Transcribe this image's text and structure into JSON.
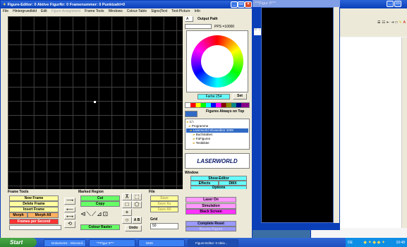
{
  "main_window": {
    "title": "Figure-Editor: 0 Aktive FigurNr: 0 Framenummer: 0 Punktzahl=0",
    "menu": [
      {
        "label": "File",
        "dim": false
      },
      {
        "label": "Hintergrundbild",
        "dim": false
      },
      {
        "label": "Edit",
        "dim": false
      },
      {
        "label": "Figure Assignment",
        "dim": true
      },
      {
        "label": "Frame Tools",
        "dim": false
      },
      {
        "label": "Windows",
        "dim": false
      },
      {
        "label": "Colour-Table",
        "dim": false
      },
      {
        "label": "Signs|Text",
        "dim": false
      },
      {
        "label": "Text-Picture",
        "dim": false
      },
      {
        "label": "Info",
        "dim": false
      }
    ]
  },
  "right_panel": {
    "output_select": "A",
    "output_path_label": "Output Path",
    "pps_label": "PPS =10000",
    "farbe_label": "Farbe 254",
    "set_button": "Set",
    "figures_always_on_top": "Figures Always on Top",
    "tree": [
      {
        "label": "C:\\",
        "selected": false
      },
      {
        "label": "Programme",
        "selected": false
      },
      {
        "label": "Laserworld Showeditor 2009",
        "selected": true
      },
      {
        "label": "Buchstaben",
        "selected": false
      },
      {
        "label": "FaFiguren",
        "selected": false
      },
      {
        "label": "Testbilder",
        "selected": false
      }
    ],
    "logo_text": "LASERWORLD"
  },
  "window_section": {
    "label": "Window",
    "show_editor": "Show-Editor",
    "effects": "Effects",
    "dmx": "DMX",
    "options": "Options"
  },
  "frame_tools": {
    "label": "Frame Tools",
    "new_frame": "New Frame",
    "delete_frame": "Delete Frame",
    "insert_frame": "Insert Frame",
    "morph": "Morph",
    "morph_all": "Morph All",
    "frames_per_second": "Frames per Second"
  },
  "marked_region": {
    "label": "Marked Region",
    "cut": "Cut",
    "copy": "Copy",
    "colour_raster": "Colour Raster"
  },
  "draw_tools": {
    "undo": "Undo",
    "ab": "A B"
  },
  "file_section": {
    "label": "File",
    "save": "Save",
    "save_as": "Save As",
    "save_all": "Save All"
  },
  "grid_section": {
    "label": "Grid",
    "value": "50"
  },
  "laser_section": {
    "laser_on": "Laser On",
    "simulation": "Simulation",
    "black_screen": "Black Screen",
    "complete_reset": "Complete Reset",
    "laser_blocked": "Blocke Figure"
  },
  "figur_window": {
    "title": "***Figur 0***"
  },
  "word_window": {
    "ruler_mark": "12 · 1"
  },
  "taskbar": {
    "start": "Start",
    "items": [
      {
        "label": "Dokument1 - Microsof...",
        "active": false
      },
      {
        "label": "***Figur 0***",
        "active": false
      },
      {
        "label": "DMX",
        "active": false
      },
      {
        "label": "Figure-Editor: 0 Aktiv...",
        "active": true
      }
    ],
    "lang": "DE",
    "clock": "10:48"
  },
  "colors": {
    "save_yellow": "#ffff99",
    "new_frame_yellow": "#ffffa0",
    "cut_green": "#66ff66",
    "laser_on_pink": "#ff99ff",
    "black_screen_magenta": "#ff33ff",
    "complete_reset_violet": "#9999ff",
    "options_cyan": "#66ffff",
    "frames_red": "#ff3333"
  }
}
